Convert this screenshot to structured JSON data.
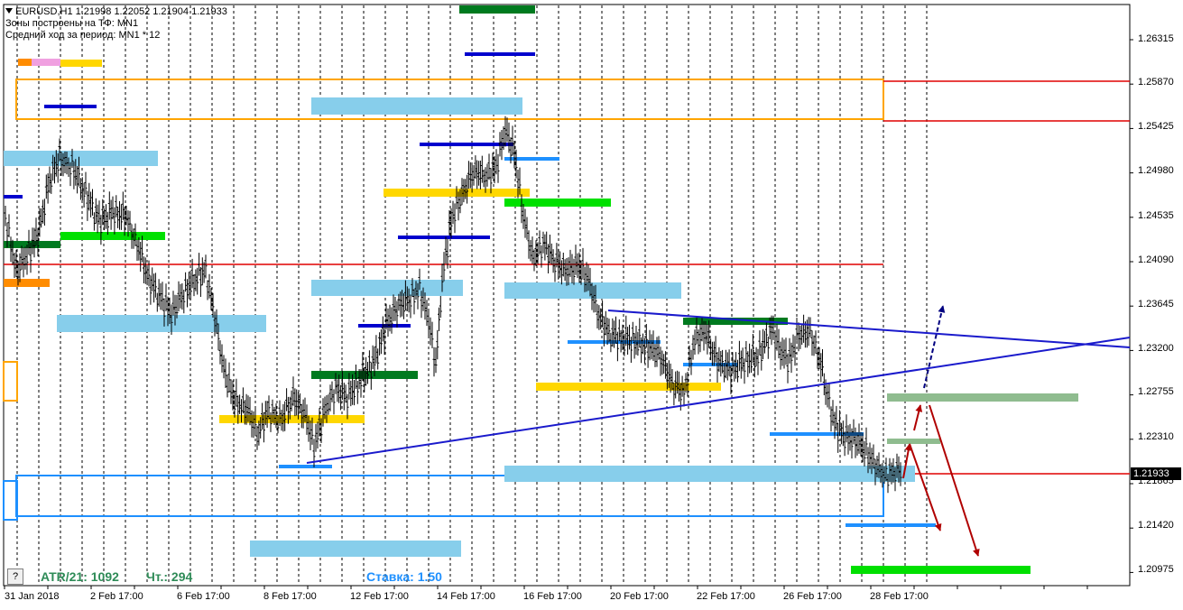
{
  "header": {
    "symbol_line": "EURUSD,H1  1.21998 1.22052 1.21904 1.21933",
    "zones_line": "Зоны построены на ТФ: MN1",
    "avg_line": "Средний ход за период: MN1 * 12"
  },
  "price_axis": [
    "1.26315",
    "1.25870",
    "1.25425",
    "1.24980",
    "1.24535",
    "1.24090",
    "1.23645",
    "1.23200",
    "1.22755",
    "1.22310",
    "1.21865",
    "1.21420",
    "1.20975"
  ],
  "current_price": "1.21933",
  "time_axis": [
    "31 Jan 2018",
    "2 Feb 17:00",
    "6 Feb 17:00",
    "8 Feb 17:00",
    "12 Feb 17:00",
    "14 Feb 17:00",
    "16 Feb 17:00",
    "20 Feb 17:00",
    "22 Feb 17:00",
    "26 Feb 17:00",
    "28 Feb 17:00"
  ],
  "status": {
    "help": "?",
    "atr": "ATR/21: 1092",
    "ticks": "Чт.: 294",
    "rate": "Ставка: 1.50"
  },
  "colors": {
    "light_blue_zone": "#87ceeb",
    "dark_green": "#007a1f",
    "bright_green": "#00e000",
    "gold": "#ffd700",
    "dark_blue": "#0000cd",
    "sky_blue": "#1e90ff",
    "orange": "#ffa500",
    "red": "#e00000",
    "dark_red": "#b00000",
    "grey_green": "#8fbc8f",
    "trend_blue": "#1a1acc"
  }
}
